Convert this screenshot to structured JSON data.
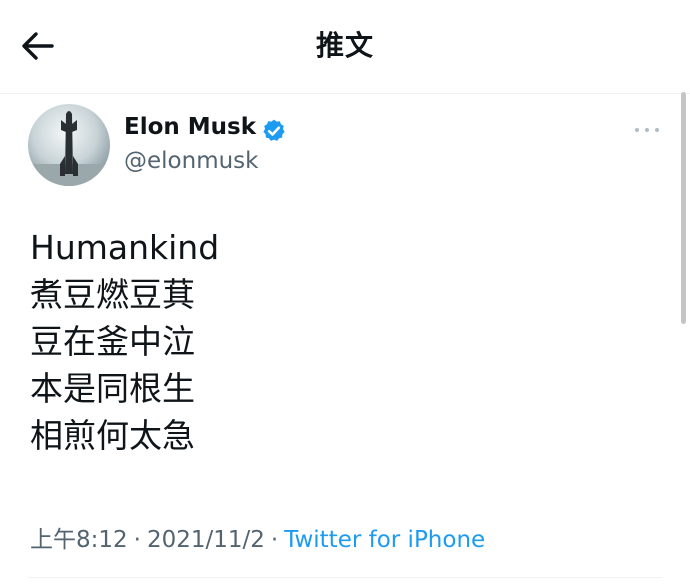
{
  "header": {
    "title": "推文",
    "back_icon": "arrow-left-icon"
  },
  "tweet": {
    "author": {
      "name": "Elon Musk",
      "handle": "@elonmusk",
      "verified": true,
      "verified_color": "#1d9bf0"
    },
    "more_icon": "more-horizontal-icon",
    "lines": [
      "Humankind",
      "煮豆燃豆萁",
      "豆在釜中泣",
      "本是同根生",
      "相煎何太急"
    ],
    "meta": {
      "time": "上午8:12",
      "separator": "·",
      "date": "2021/11/2",
      "source": "Twitter for iPhone",
      "source_color": "#1d9bf0"
    }
  }
}
